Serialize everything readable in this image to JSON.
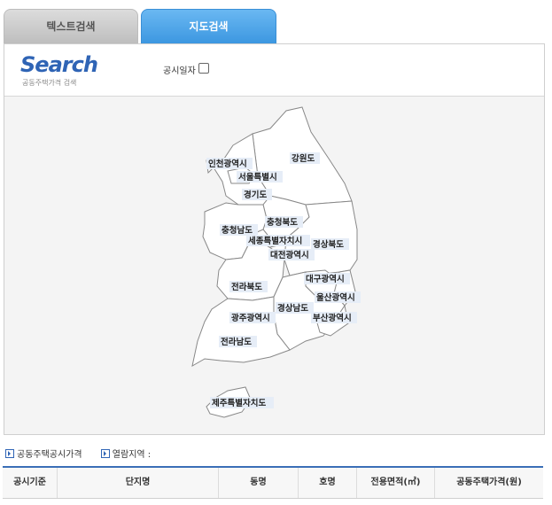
{
  "tabs": [
    "텍스트검색",
    "지도검색"
  ],
  "header": {
    "logo": "Search",
    "subtitle": "공동주택가격 검색",
    "checkbox_label": "공시일자"
  },
  "map": {
    "regions": [
      {
        "id": "incheon",
        "label": "인천광역시"
      },
      {
        "id": "seoul",
        "label": "서울특별시"
      },
      {
        "id": "gyeonggi",
        "label": "경기도"
      },
      {
        "id": "gangwon",
        "label": "강원도"
      },
      {
        "id": "chungbuk",
        "label": "충청북도"
      },
      {
        "id": "chungnam",
        "label": "충청남도"
      },
      {
        "id": "sejong",
        "label": "세종특별자치시"
      },
      {
        "id": "gyeongbuk",
        "label": "경상북도"
      },
      {
        "id": "daejeon",
        "label": "대전광역시"
      },
      {
        "id": "daegu",
        "label": "대구광역시"
      },
      {
        "id": "jeonbuk",
        "label": "전라북도"
      },
      {
        "id": "ulsan",
        "label": "울산광역시"
      },
      {
        "id": "gyeongnam",
        "label": "경상남도"
      },
      {
        "id": "gwangju",
        "label": "광주광역시"
      },
      {
        "id": "busan",
        "label": "부산광역시"
      },
      {
        "id": "jeonnam",
        "label": "전라남도"
      },
      {
        "id": "jeju",
        "label": "제주특별자치도"
      }
    ]
  },
  "legend": {
    "item1": "공동주택공시가격",
    "item2": "열람지역 :"
  },
  "table": {
    "headers": [
      "공시기준",
      "단지명",
      "동명",
      "호명",
      "전용면적(㎡)",
      "공동주택가격(원)"
    ]
  }
}
